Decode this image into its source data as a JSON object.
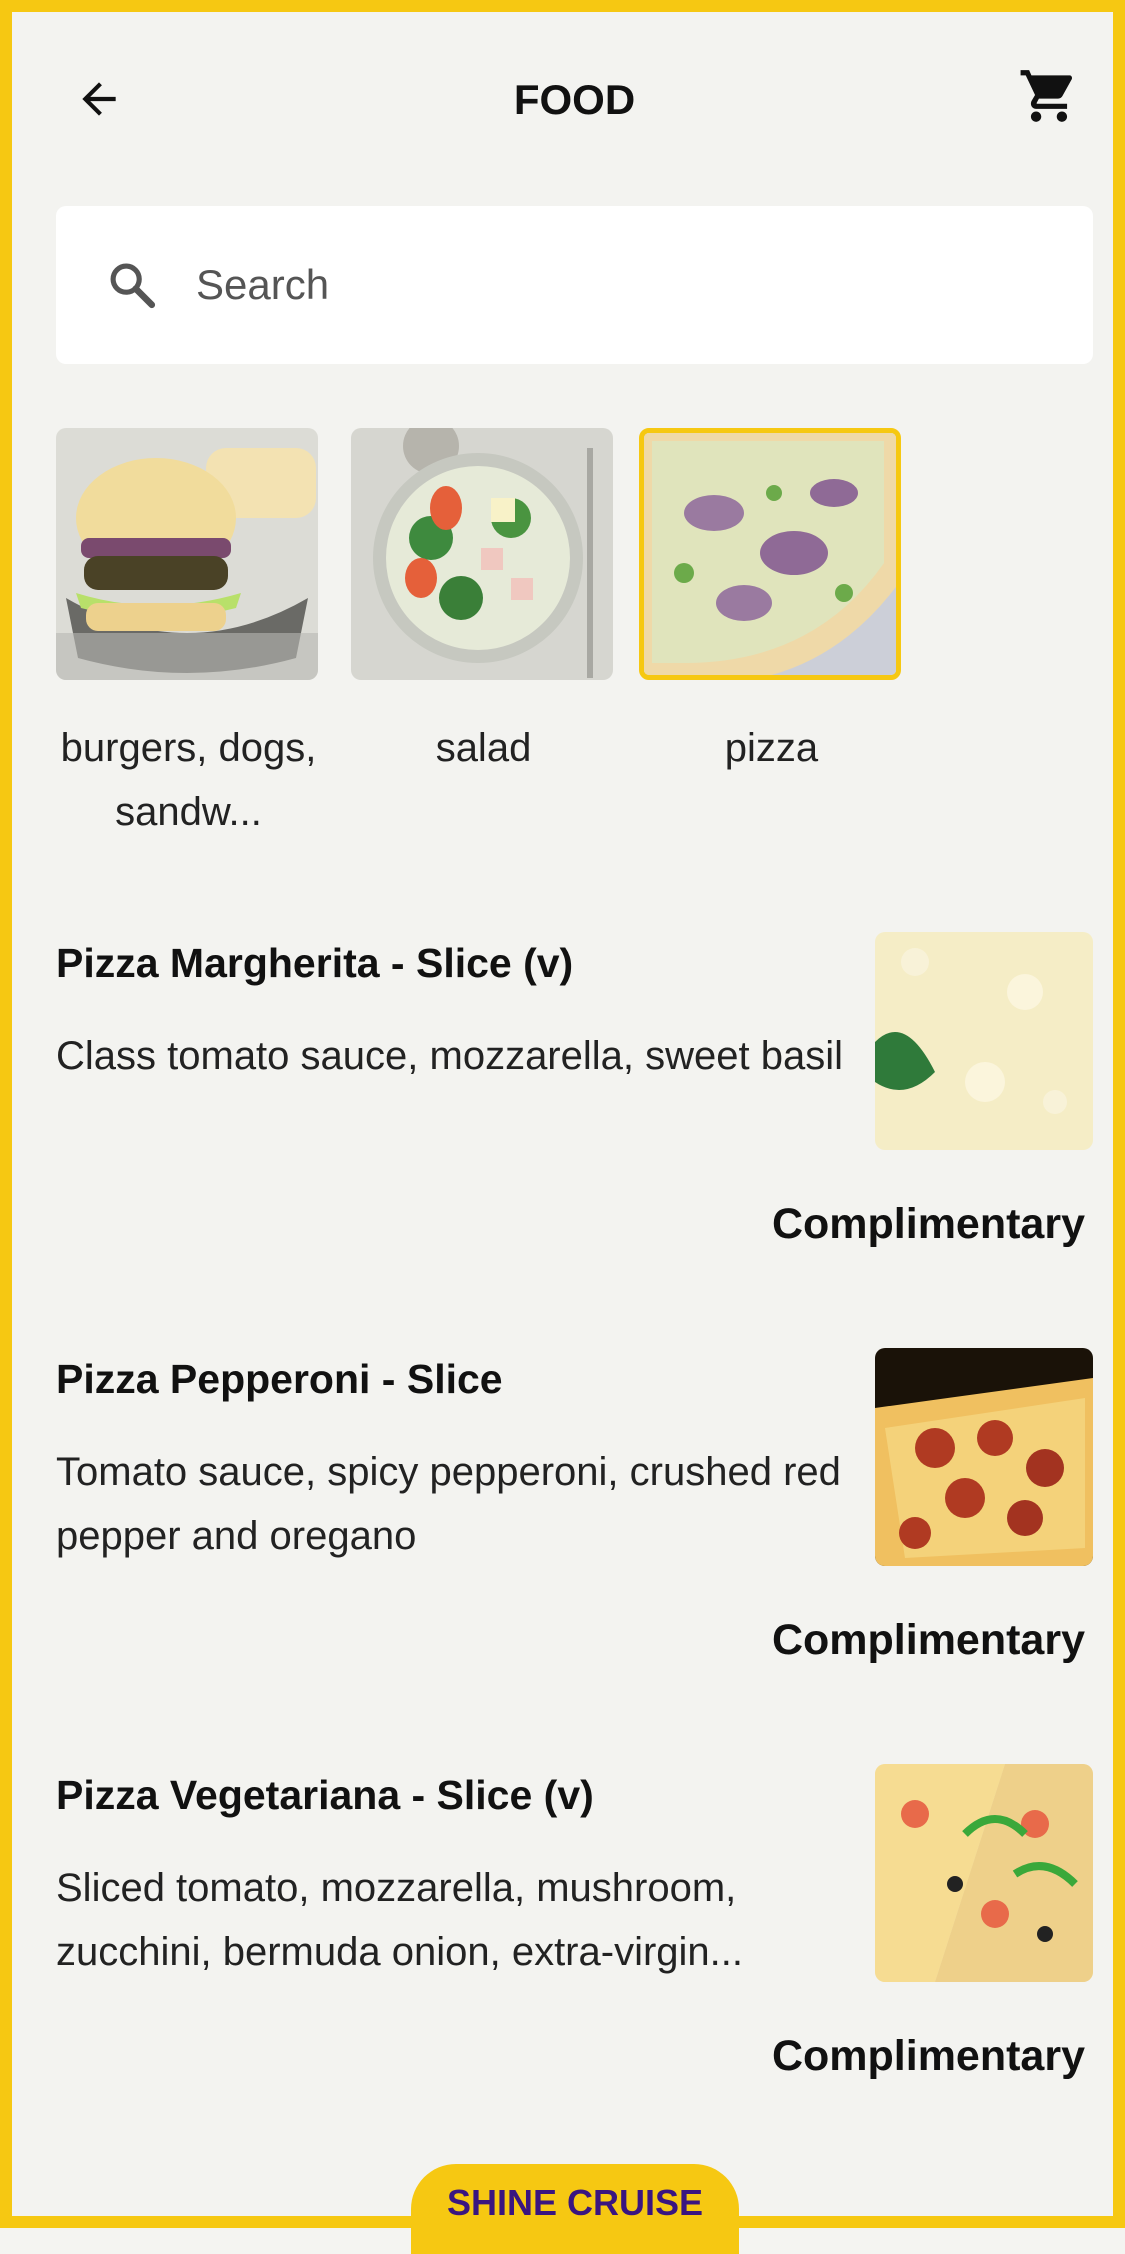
{
  "header": {
    "title": "FOOD"
  },
  "search": {
    "placeholder": "Search"
  },
  "categories": [
    {
      "label": "burgers, dogs, sandw...",
      "selected": false
    },
    {
      "label": "salad",
      "selected": false
    },
    {
      "label": "pizza",
      "selected": true
    }
  ],
  "items": [
    {
      "name": "Pizza Margherita - Slice (v)",
      "description": "Class tomato sauce, mozzarella, sweet basil",
      "price": "Complimentary"
    },
    {
      "name": "Pizza Pepperoni - Slice",
      "description": "Tomato sauce, spicy pepperoni, crushed red pepper and oregano",
      "price": "Complimentary"
    },
    {
      "name": "Pizza Vegetariana - Slice (v)",
      "description": "Sliced tomato, mozzarella, mushroom, zucchini, bermuda onion, extra-virgin...",
      "price": "Complimentary"
    }
  ],
  "footer": {
    "brand": "SHINE CRUISE"
  },
  "colors": {
    "accent": "#f6c812",
    "brand_text": "#3a1580"
  },
  "icons": {
    "back": "arrow-left-icon",
    "cart": "cart-icon",
    "search": "search-icon"
  }
}
